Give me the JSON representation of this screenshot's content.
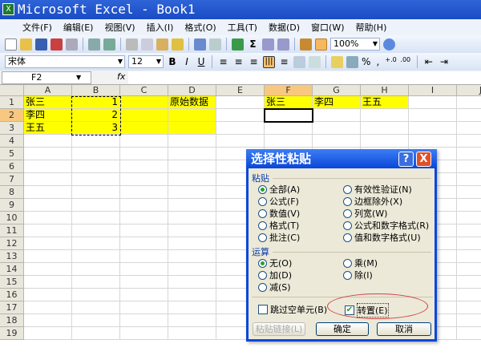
{
  "window": {
    "title": "Microsoft Excel - Book1"
  },
  "menu": [
    "文件(F)",
    "编辑(E)",
    "视图(V)",
    "插入(I)",
    "格式(O)",
    "工具(T)",
    "数据(D)",
    "窗口(W)",
    "帮助(H)"
  ],
  "toolbar": {
    "zoom": "100%",
    "font": "宋体",
    "size": "12",
    "bold": "B",
    "italic": "I",
    "underline": "U",
    "percent": "%",
    "comma": ","
  },
  "formula_bar": {
    "name_box": "F2",
    "fx": "fx",
    "value": ""
  },
  "columns": [
    "A",
    "B",
    "C",
    "D",
    "E",
    "F",
    "G",
    "H",
    "I",
    "J"
  ],
  "rows": [
    "1",
    "2",
    "3",
    "4",
    "5",
    "6",
    "7",
    "8",
    "9",
    "10",
    "11",
    "12",
    "13",
    "14",
    "15",
    "16",
    "17",
    "18",
    "19"
  ],
  "cells": {
    "A1": "张三",
    "A2": "李四",
    "A3": "王五",
    "B1": "1",
    "B2": "2",
    "B3": "3",
    "D1": "原始数据",
    "F1": "张三",
    "G1": "李四",
    "H1": "王五"
  },
  "dialog": {
    "title": "选择性粘贴",
    "help": "?",
    "close": "X",
    "paste_group": "粘贴",
    "paste_left": [
      "全部(A)",
      "公式(F)",
      "数值(V)",
      "格式(T)",
      "批注(C)"
    ],
    "paste_right": [
      "有效性验证(N)",
      "边框除外(X)",
      "列宽(W)",
      "公式和数字格式(R)",
      "值和数字格式(U)"
    ],
    "op_group": "运算",
    "op_left": [
      "无(O)",
      "加(D)",
      "减(S)"
    ],
    "op_right": [
      "乘(M)",
      "除(I)"
    ],
    "skip_blanks": "跳过空单元(B)",
    "transpose": "转置(E)",
    "paste_link": "粘贴链接(L)",
    "ok": "确定",
    "cancel": "取消"
  }
}
